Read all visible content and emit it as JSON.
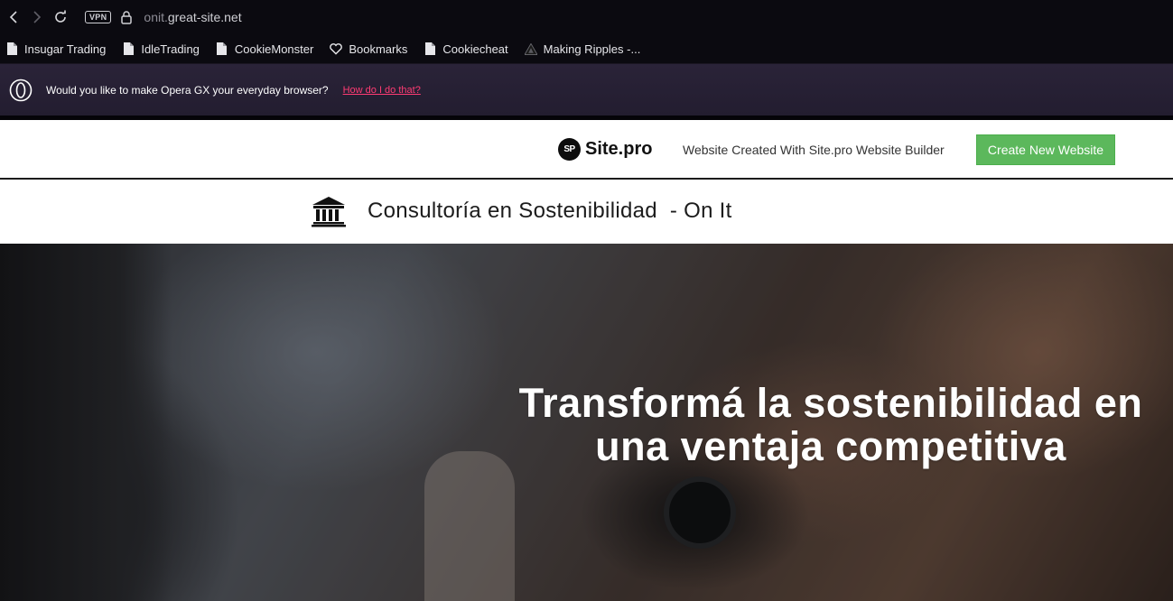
{
  "browser": {
    "url_subdomain": "onit.",
    "url_domain": "great-site.net",
    "vpn_label": "VPN",
    "bookmarks": [
      {
        "label": "Insugar Trading",
        "icon": "page-icon"
      },
      {
        "label": "IdleTrading",
        "icon": "page-icon"
      },
      {
        "label": "CookieMonster",
        "icon": "page-icon"
      },
      {
        "label": "Bookmarks",
        "icon": "heart-icon"
      },
      {
        "label": "Cookiecheat",
        "icon": "page-icon"
      },
      {
        "label": "Making Ripples -...",
        "icon": "triangle-logo-icon"
      }
    ]
  },
  "notification": {
    "message": "Would you like to make Opera GX your everyday browser?",
    "link": "How do I do that?"
  },
  "sitepro_banner": {
    "logo_badge": "SP",
    "logo_name": "Site.pro",
    "tagline": "Website Created With Site.pro Website Builder",
    "cta_label": "Create New Website"
  },
  "site": {
    "title": "Consultoría en Sostenibilidad  - On It",
    "hero_line1": "Transformá la sostenibilidad en",
    "hero_line2": "una ventaja competitiva"
  },
  "colors": {
    "cta_green": "#5cb85c",
    "opera_link": "#ff3b73",
    "browser_bg": "#0b0a10"
  }
}
